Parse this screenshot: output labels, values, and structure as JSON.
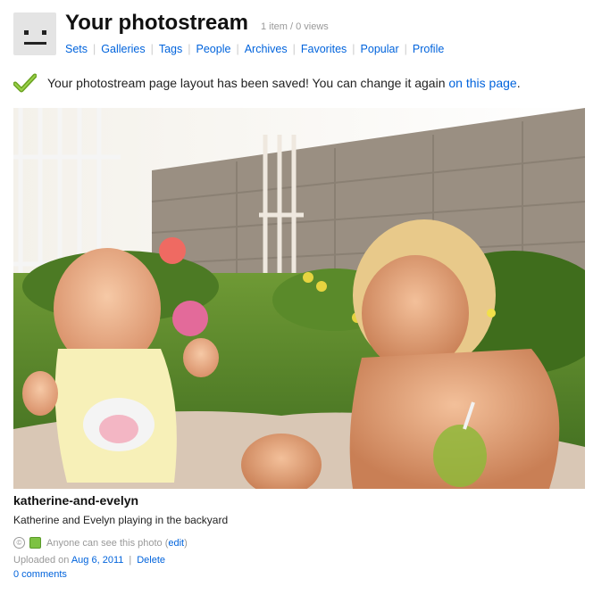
{
  "header": {
    "title": "Your photostream",
    "counts": "1 item / 0 views",
    "nav": [
      "Sets",
      "Galleries",
      "Tags",
      "People",
      "Archives",
      "Favorites",
      "Popular",
      "Profile"
    ]
  },
  "notice": {
    "text": "Your photostream page layout has been saved! You can change it again ",
    "link": "on this page",
    "end": "."
  },
  "photo": {
    "title": "katherine-and-evelyn",
    "description": "Katherine and Evelyn playing in the backyard",
    "privacy_text": "Anyone can see this photo (",
    "privacy_edit": "edit",
    "privacy_close": ")",
    "uploaded_label": "Uploaded on ",
    "uploaded_date": "Aug 6, 2011",
    "separator": "|",
    "delete_label": "Delete",
    "comments": "0 comments"
  },
  "colors": {
    "link": "#0063dc",
    "muted": "#999999",
    "check": "#6aa321"
  },
  "icons": [
    "buddy-icon",
    "checkmark-icon",
    "creative-commons-icon",
    "public-privacy-icon"
  ]
}
